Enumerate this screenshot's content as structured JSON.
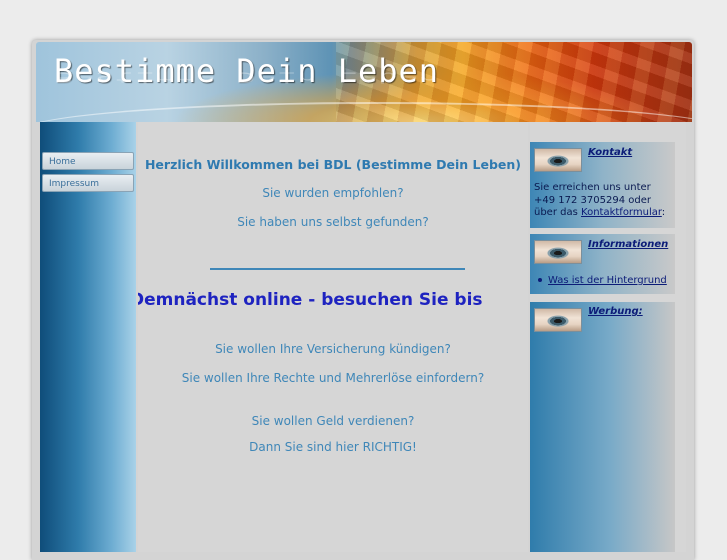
{
  "header": {
    "title": "Bestimme Dein Leben"
  },
  "nav": {
    "items": [
      "Home",
      "Impressum"
    ]
  },
  "main": {
    "welcome": "Herzlich Willkommen bei BDL (Bestimme Dein Leben)",
    "line1": "Sie wurden empfohlen?",
    "line2": "Sie haben uns selbst gefunden?",
    "marquee": "Demnächst online - besuchen Sie bis",
    "line3": "Sie wollen Ihre Versicherung kündigen?",
    "line4": "Sie wollen Ihre Rechte und Mehrerlöse einfordern?",
    "line5": "Sie wollen Geld verdienen?",
    "line6": "Dann Sie sind hier RICHTIG!"
  },
  "sidebar": {
    "kontakt": {
      "title": "Kontakt",
      "text1": "Sie erreichen uns unter",
      "phone": "+49 172 3705294 oder",
      "text2": "über das",
      "link": "Kontaktformular",
      "after": ":"
    },
    "informationen": {
      "title": "Informationen",
      "link": "Was ist der Hintergrund"
    },
    "werbung": {
      "title": "Werbung:"
    }
  }
}
